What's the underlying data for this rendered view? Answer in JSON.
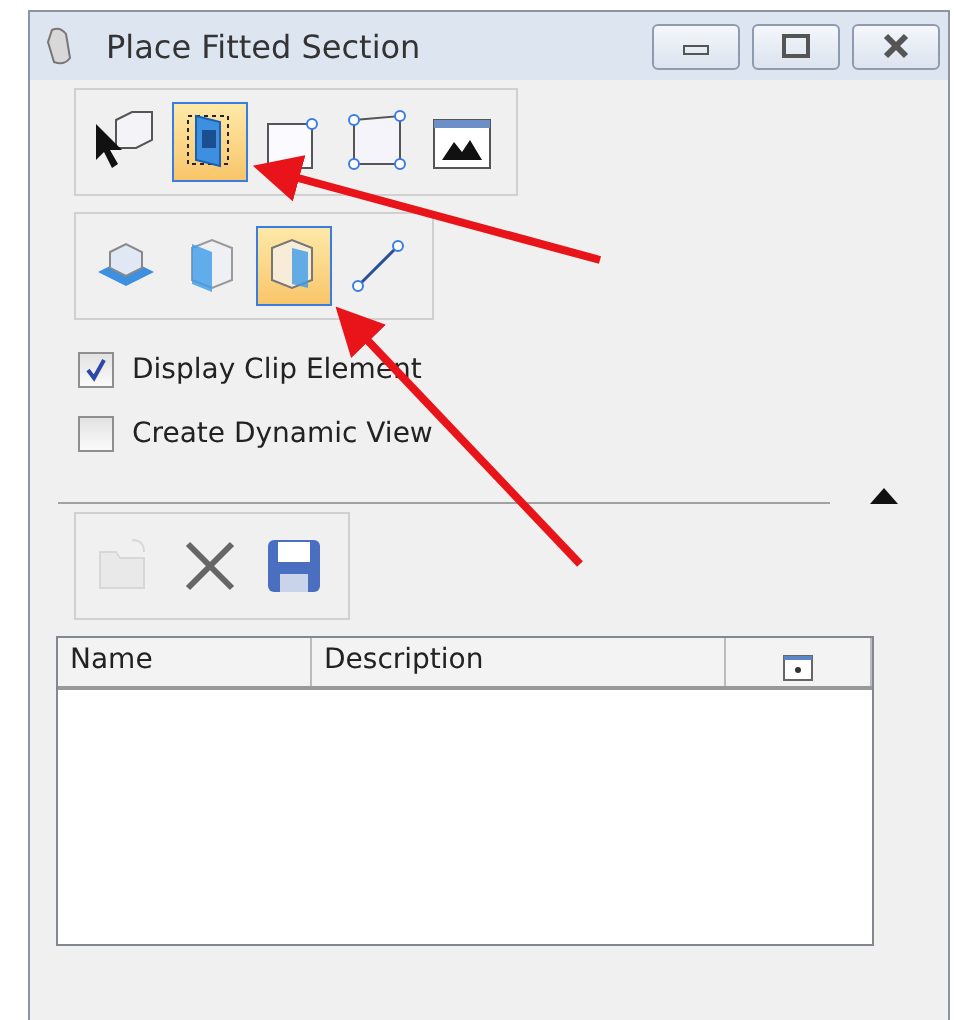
{
  "window": {
    "title": "Place Fitted Section"
  },
  "toolbars": [
    {
      "items": [
        {
          "kind": "select",
          "selected": false
        },
        {
          "kind": "fitted",
          "selected": true
        },
        {
          "kind": "rectangle",
          "selected": false
        },
        {
          "kind": "shape",
          "selected": false
        },
        {
          "kind": "view",
          "selected": false
        }
      ]
    },
    {
      "items": [
        {
          "kind": "plane",
          "selected": false
        },
        {
          "kind": "box",
          "selected": false
        },
        {
          "kind": "volume",
          "selected": true
        },
        {
          "kind": "line",
          "selected": false
        }
      ]
    }
  ],
  "options": [
    {
      "label": "Display Clip Element",
      "checked": true
    },
    {
      "label": "Create Dynamic View",
      "checked": false
    }
  ],
  "saved_toolbar": {
    "items": [
      {
        "kind": "open",
        "disabled": true
      },
      {
        "kind": "delete",
        "disabled": false
      },
      {
        "kind": "save",
        "disabled": false
      }
    ]
  },
  "table": {
    "columns": [
      {
        "label": "Name"
      },
      {
        "label": "Description"
      },
      {
        "kind": "picker"
      }
    ]
  },
  "annotations": [
    {
      "kind": "arrow"
    },
    {
      "kind": "arrow"
    }
  ]
}
